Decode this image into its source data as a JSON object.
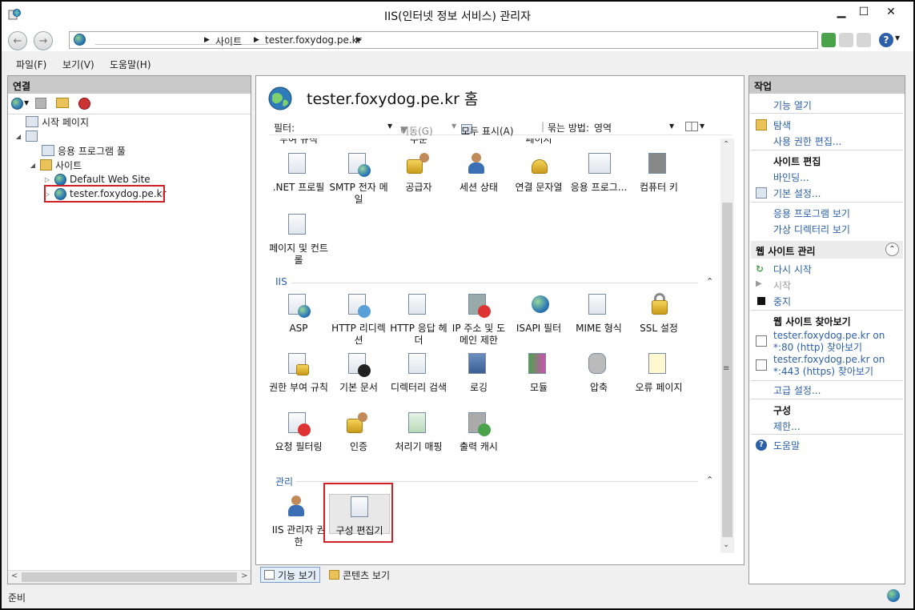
{
  "window": {
    "title": "IIS(인터넷 정보 서비스) 관리자"
  },
  "address": {
    "path": [
      "사이트",
      "tester.foxydog.pe.kr"
    ]
  },
  "menu": {
    "items": [
      "파일(F)",
      "보기(V)",
      "도움말(H)"
    ]
  },
  "connections": {
    "header": "연결",
    "tree": {
      "start_page": "시작 페이지",
      "server": "",
      "app_pools": "응용 프로그램 풀",
      "sites": "사이트",
      "default_site": "Default Web Site",
      "selected_site": "tester.foxydog.pe.kr"
    }
  },
  "center": {
    "title": "tester.foxydog.pe.kr 홈",
    "filter": {
      "label": "필터:",
      "go": "이동(G)",
      "show_all": "모두 표시(A)",
      "group_by": "묶는 방법:",
      "group_value": "영역"
    },
    "partial_row": [
      "부여 규칙",
      "주문",
      "페이지"
    ],
    "aspnet_features": [
      ".NET 프로필",
      "SMTP 전자 메일",
      "공급자",
      "세션 상태",
      "연결 문자열",
      "응용 프로그...",
      "컴퓨터 키",
      "페이지 및 컨트롤"
    ],
    "iis_group": "IIS",
    "iis_features": [
      "ASP",
      "HTTP 리디렉션",
      "HTTP 응답 헤더",
      "IP 주소 및 도메인 제한",
      "ISAPI 필터",
      "MIME 형식",
      "SSL 설정",
      "권한 부여 규칙",
      "기본 문서",
      "디렉터리 검색",
      "로깅",
      "모듈",
      "압축",
      "오류 페이지",
      "요청 필터링",
      "인증",
      "처리기 매핑",
      "출력 캐시"
    ],
    "mgmt_group": "관리",
    "mgmt_features": [
      "IIS 관리자 권한",
      "구성 편집기"
    ]
  },
  "view_tabs": [
    "기능 보기",
    "콘텐츠 보기"
  ],
  "actions": {
    "header": "작업",
    "open_feature": "기능 열기",
    "explore": "탐색",
    "edit_permissions": "사용 권한 편집...",
    "edit_site_header": "사이트 편집",
    "bindings": "바인딩...",
    "basic_settings": "기본 설정...",
    "view_apps": "응용 프로그램 보기",
    "view_vdirs": "가상 디렉터리 보기",
    "manage_site_header": "웹 사이트 관리",
    "restart": "다시 시작",
    "start": "시작",
    "stop": "중지",
    "browse_header": "웹 사이트 찾아보기",
    "browse_http": "tester.foxydog.pe.kr on *:80 (http) 찾아보기",
    "browse_https": "tester.foxydog.pe.kr on *:443 (https) 찾아보기",
    "advanced": "고급 설정...",
    "config_header": "구성",
    "limits": "제한...",
    "help": "도움말"
  },
  "status": {
    "text": "준비"
  }
}
